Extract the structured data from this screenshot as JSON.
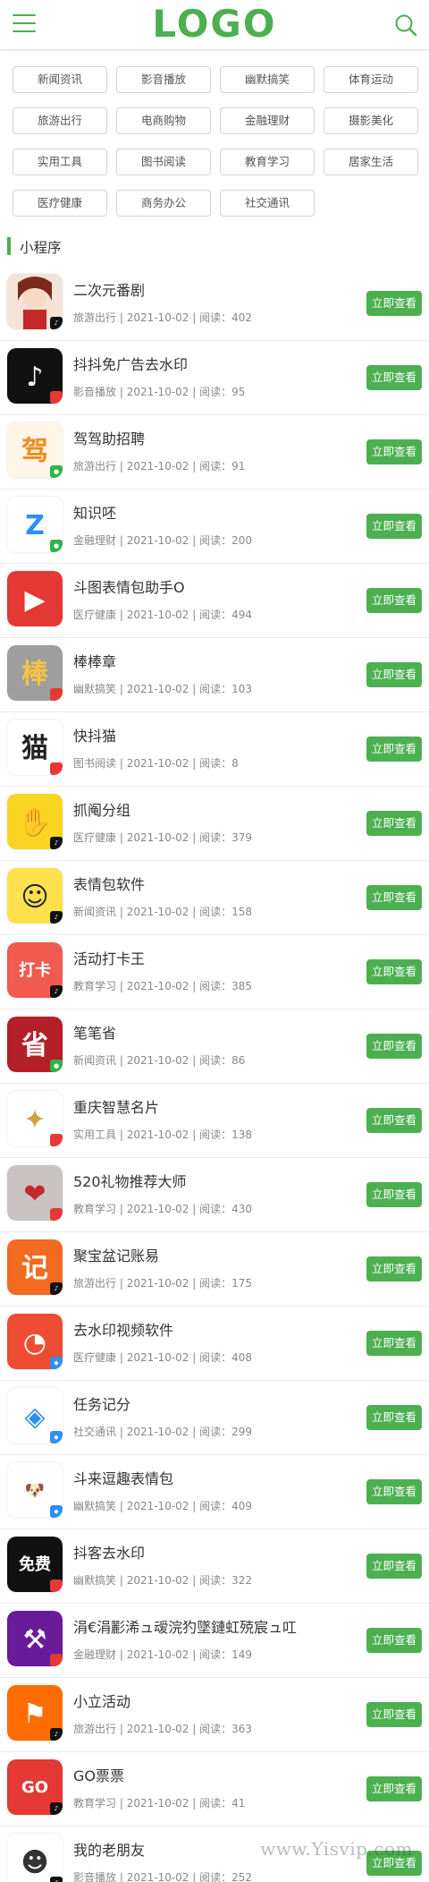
{
  "header": {
    "logo": "LOGO"
  },
  "categories": [
    "新闻资讯",
    "影音播放",
    "幽默搞笑",
    "体育运动",
    "旅游出行",
    "电商购物",
    "金融理财",
    "摄影美化",
    "实用工具",
    "图书阅读",
    "教育学习",
    "居家生活",
    "医疗健康",
    "商务办公",
    "社交通讯"
  ],
  "section": {
    "title": "小程序"
  },
  "items": [
    {
      "name": "二次元番剧",
      "category": "旅游出行",
      "date": "2021-10-02",
      "reads": "402",
      "icon": "anime-girl-icon",
      "bg": "#f4e3d7",
      "fg": "#7a2a1e",
      "glyph": "",
      "badge": "tiktok"
    },
    {
      "name": "抖抖免广告去水印",
      "category": "影音播放",
      "date": "2021-10-02",
      "reads": "95",
      "icon": "tiktok-logo-icon",
      "bg": "#111111",
      "fg": "#ffffff",
      "glyph": "♪",
      "badge": "red"
    },
    {
      "name": "驾驾助招聘",
      "category": "旅游出行",
      "date": "2021-10-02",
      "reads": "91",
      "icon": "recruit-icon",
      "bg": "#fff6e8",
      "fg": "#f08a1d",
      "glyph": "驾",
      "badge": "wechat"
    },
    {
      "name": "知识呸",
      "category": "金融理财",
      "date": "2021-10-02",
      "reads": "200",
      "icon": "letter-z-icon",
      "bg": "#ffffff",
      "fg": "#2f8ff3",
      "glyph": "Z",
      "badge": "wechat"
    },
    {
      "name": "斗图表情包助手O",
      "category": "医疗健康",
      "date": "2021-10-02",
      "reads": "494",
      "icon": "play-button-icon",
      "bg": "#e53935",
      "fg": "#ffffff",
      "glyph": "▶",
      "badge": "red"
    },
    {
      "name": "棒棒章",
      "category": "幽默搞笑",
      "date": "2021-10-02",
      "reads": "103",
      "icon": "medal-icon",
      "bg": "#9e9e9e",
      "fg": "#f6c343",
      "glyph": "棒",
      "badge": "red"
    },
    {
      "name": "快抖猫",
      "category": "图书阅读",
      "date": "2021-10-02",
      "reads": "8",
      "icon": "cat-icon",
      "bg": "#ffffff",
      "fg": "#222222",
      "glyph": "猫",
      "badge": "red"
    },
    {
      "name": "抓阄分组",
      "category": "医疗健康",
      "date": "2021-10-02",
      "reads": "379",
      "icon": "hand-icon",
      "bg": "#f9d423",
      "fg": "#ffffff",
      "glyph": "✋",
      "badge": "tiktok"
    },
    {
      "name": "表情包软件",
      "category": "新闻资讯",
      "date": "2021-10-02",
      "reads": "158",
      "icon": "meme-face-icon",
      "bg": "#ffe14d",
      "fg": "#222222",
      "glyph": "☺",
      "badge": "tiktok"
    },
    {
      "name": "活动打卡王",
      "category": "教育学习",
      "date": "2021-10-02",
      "reads": "385",
      "icon": "checkin-icon",
      "bg": "#f05a4f",
      "fg": "#ffffff",
      "glyph": "打卡",
      "badge": "tiktok"
    },
    {
      "name": "笔笔省",
      "category": "新闻资讯",
      "date": "2021-10-02",
      "reads": "86",
      "icon": "save-money-icon",
      "bg": "#b3202a",
      "fg": "#ffffff",
      "glyph": "省",
      "badge": "wechat"
    },
    {
      "name": "重庆智慧名片",
      "category": "实用工具",
      "date": "2021-10-02",
      "reads": "138",
      "icon": "gold-emblem-icon",
      "bg": "#ffffff",
      "fg": "#caa33a",
      "glyph": "✦",
      "badge": "red"
    },
    {
      "name": "520礼物推荐大师",
      "category": "教育学习",
      "date": "2021-10-02",
      "reads": "430",
      "icon": "gift-icon",
      "bg": "#c9c3c3",
      "fg": "#c62828",
      "glyph": "❤",
      "badge": "red"
    },
    {
      "name": "聚宝盆记账易",
      "category": "旅游出行",
      "date": "2021-10-02",
      "reads": "175",
      "icon": "ledger-icon",
      "bg": "#f26b21",
      "fg": "#ffffff",
      "glyph": "记",
      "badge": "tiktok"
    },
    {
      "name": "去水印视频软件",
      "category": "医疗健康",
      "date": "2021-10-02",
      "reads": "408",
      "icon": "clock-pie-icon",
      "bg": "#ef4c34",
      "fg": "#ffffff",
      "glyph": "◔",
      "badge": "blue"
    },
    {
      "name": "任务记分",
      "category": "社交通讯",
      "date": "2021-10-02",
      "reads": "299",
      "icon": "layers-icon",
      "bg": "#ffffff",
      "fg": "#2f8ff3",
      "glyph": "◈",
      "badge": "blue"
    },
    {
      "name": "斗来逗趣表情包",
      "category": "幽默搞笑",
      "date": "2021-10-02",
      "reads": "409",
      "icon": "cute-dog-icon",
      "bg": "#ffffff",
      "fg": "#d89a5c",
      "glyph": "🐶",
      "badge": "blue"
    },
    {
      "name": "抖客去水印",
      "category": "幽默搞笑",
      "date": "2021-10-02",
      "reads": "322",
      "icon": "free-watermark-icon",
      "bg": "#111111",
      "fg": "#ffffff",
      "glyph": "免费",
      "badge": "red"
    },
    {
      "name": "涓€涓彲浠ュ叆浣犳墜鏈虹殑宸ュ叿",
      "category": "金融理财",
      "date": "2021-10-02",
      "reads": "149",
      "icon": "toolbox-icon",
      "bg": "#6a1b9a",
      "fg": "#ffffff",
      "glyph": "⚒",
      "badge": "red"
    },
    {
      "name": "小立活动",
      "category": "旅游出行",
      "date": "2021-10-02",
      "reads": "363",
      "icon": "flag-icon",
      "bg": "#ff6d00",
      "fg": "#ffffff",
      "glyph": "⚑",
      "badge": "tiktok"
    },
    {
      "name": "GO票票",
      "category": "教育学习",
      "date": "2021-10-02",
      "reads": "41",
      "icon": "ticket-icon",
      "bg": "#e53935",
      "fg": "#ffffff",
      "glyph": "GO",
      "badge": "tiktok"
    },
    {
      "name": "我的老朋友",
      "category": "影音播放",
      "date": "2021-10-02",
      "reads": "252",
      "icon": "friend-avatar-icon",
      "bg": "#ffffff",
      "fg": "#333333",
      "glyph": "☻",
      "badge": "tiktok"
    }
  ],
  "labels": {
    "open_button": "立即查看",
    "reads_prefix": "阅读：",
    "sep": " | "
  },
  "watermark": "www.Yisvip.com",
  "colors": {
    "accent": "#4caf50"
  }
}
